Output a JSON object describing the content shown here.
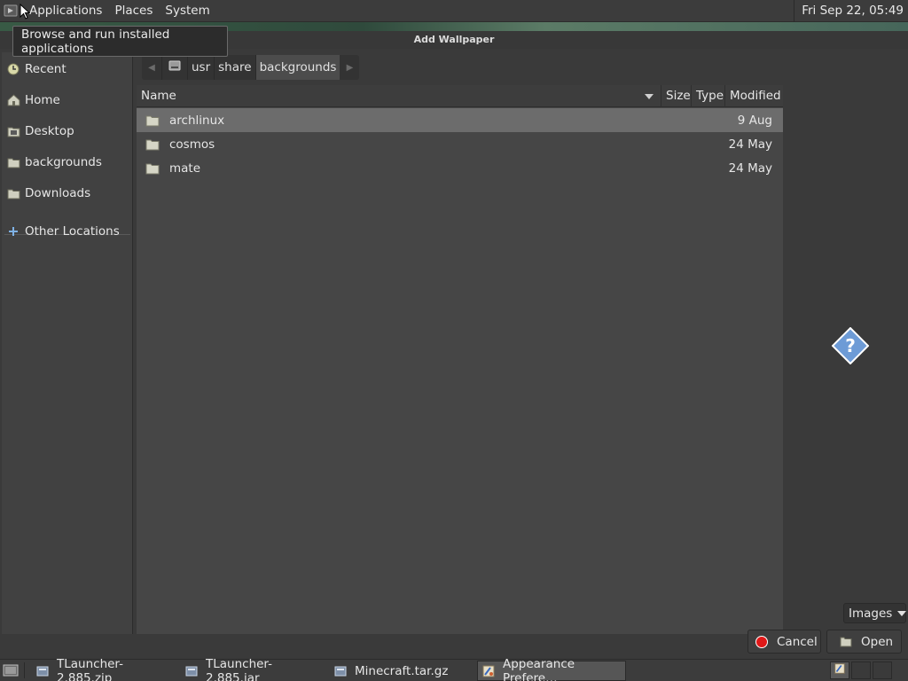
{
  "top_panel": {
    "menu": {
      "applications": "Applications",
      "places": "Places",
      "system": "System"
    },
    "clock": "Fri Sep 22, 05:49",
    "tooltip": "Browse and run installed applications"
  },
  "dialog": {
    "title": "Add Wallpaper",
    "sidebar": [
      {
        "label": "Recent",
        "icon": "recent-icon"
      },
      {
        "label": "Home",
        "icon": "home-icon"
      },
      {
        "label": "Desktop",
        "icon": "desktop-icon"
      },
      {
        "label": "backgrounds",
        "icon": "folder-icon"
      },
      {
        "label": "Downloads",
        "icon": "folder-icon"
      },
      {
        "label": "Other Locations",
        "icon": "plus-icon"
      }
    ],
    "path": [
      "usr",
      "share",
      "backgrounds"
    ],
    "columns": {
      "name": "Name",
      "size": "Size",
      "type": "Type",
      "modified": "Modified"
    },
    "files": [
      {
        "name": "archlinux",
        "modified": "9 Aug",
        "selected": true
      },
      {
        "name": "cosmos",
        "modified": "24 May",
        "selected": false
      },
      {
        "name": "mate",
        "modified": "24 May",
        "selected": false
      }
    ],
    "filter": "Images",
    "buttons": {
      "cancel": "Cancel",
      "open": "Open"
    }
  },
  "taskbar": [
    {
      "label": "TLauncher-2.885.zip",
      "icon": "archive-icon",
      "active": false
    },
    {
      "label": "TLauncher-2.885.jar",
      "icon": "archive-icon",
      "active": false
    },
    {
      "label": "Minecraft.tar.gz",
      "icon": "archive-icon",
      "active": false
    },
    {
      "label": "Appearance Prefere…",
      "icon": "appearance-icon",
      "active": true
    }
  ],
  "colors": {
    "panel": "#3c3c3c",
    "dialog": "#3a3a3a",
    "file_pane": "#464646",
    "selection": "#6c6c6c",
    "help_icon": "#5b8fd0",
    "cancel_red": "#e01818"
  }
}
